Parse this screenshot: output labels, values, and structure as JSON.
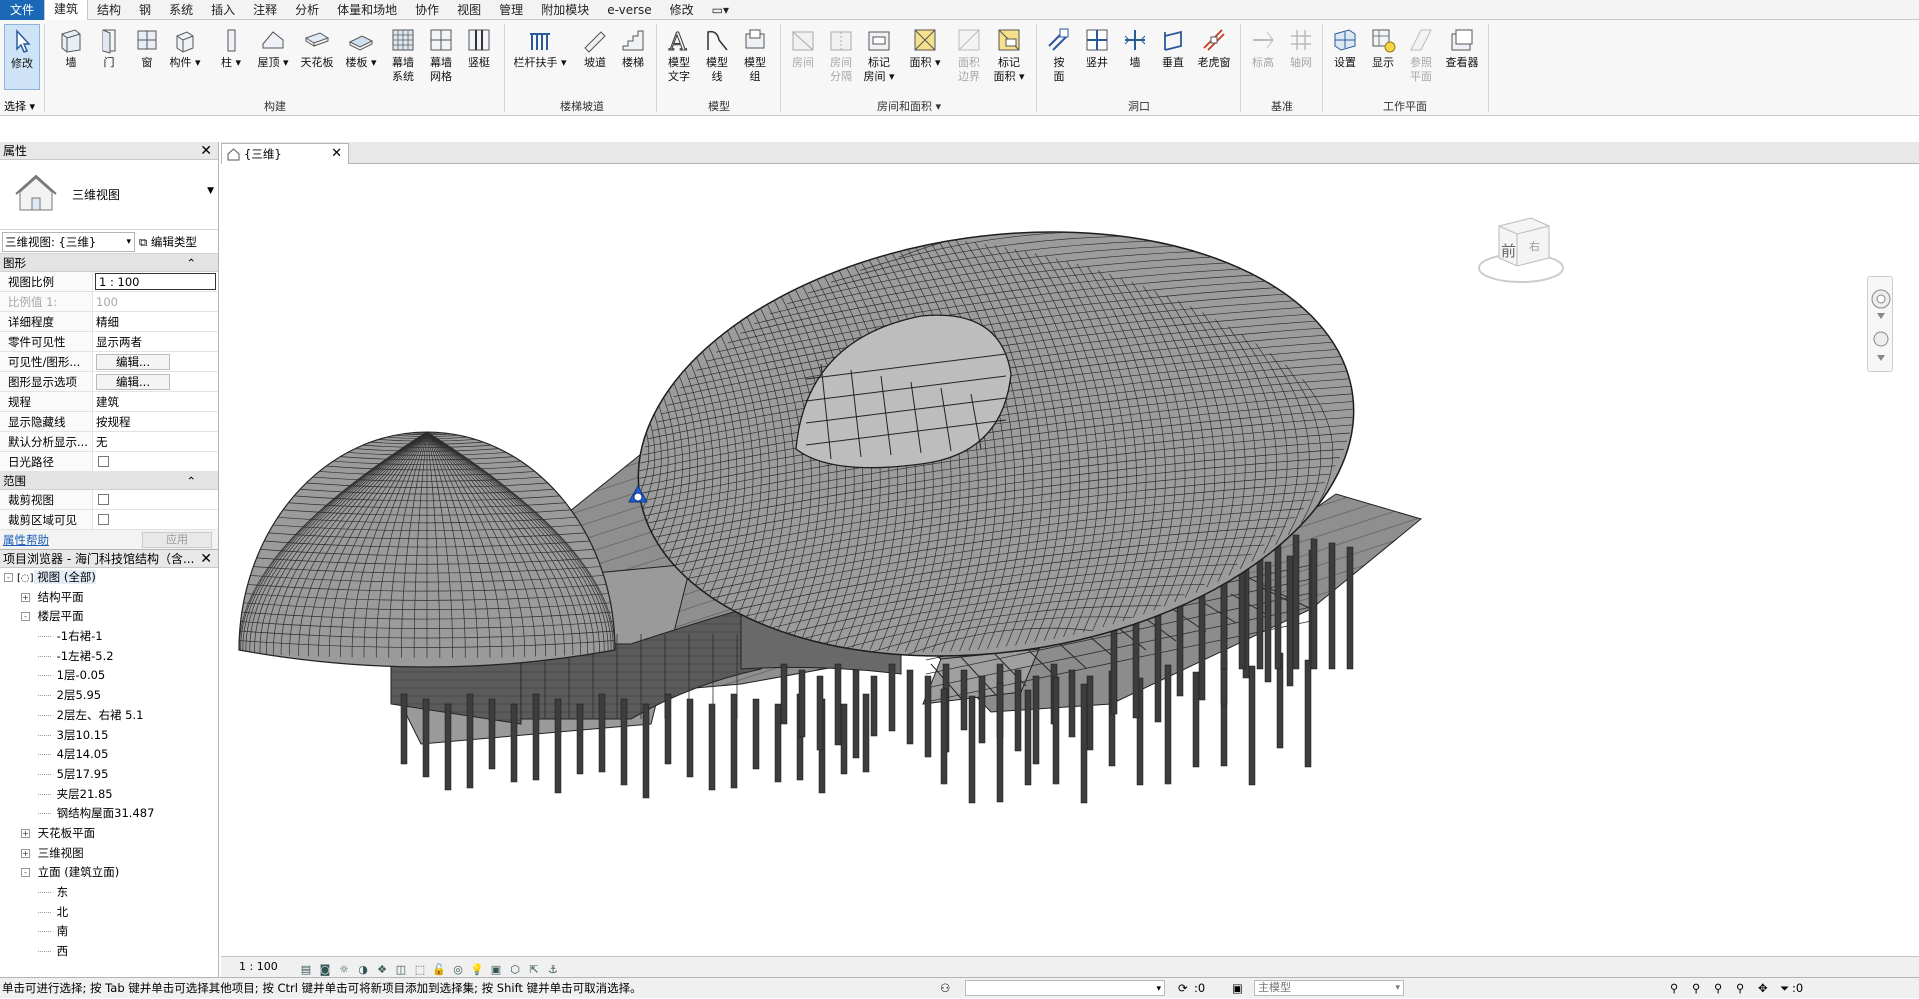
{
  "menu": {
    "tabs": [
      "文件",
      "建筑",
      "结构",
      "钢",
      "系统",
      "插入",
      "注释",
      "分析",
      "体量和场地",
      "协作",
      "视图",
      "管理",
      "附加模块",
      "e-verse",
      "修改"
    ],
    "active": "建筑"
  },
  "ribbon": {
    "modify": {
      "label": "修改"
    },
    "select_label": "选择",
    "build": {
      "label": "构建",
      "wall": "墙",
      "door": "门",
      "window": "窗",
      "component": "构件",
      "column": "柱",
      "roof": "屋顶",
      "ceiling": "天花板",
      "floor": "楼板",
      "curtain_system_l1": "幕墙",
      "curtain_system_l2": "系统",
      "curtain_grid_l1": "幕墙",
      "curtain_grid_l2": "网格",
      "mullion": "竖梃"
    },
    "circulation": {
      "label": "楼梯坡道",
      "railing": "栏杆扶手",
      "ramp": "坡道",
      "stair": "楼梯"
    },
    "model": {
      "label": "模型",
      "text_l1": "模型",
      "text_l2": "文字",
      "line_l1": "模型",
      "line_l2": "线",
      "group_l1": "模型",
      "group_l2": "组"
    },
    "room_area": {
      "label": "房间和面积",
      "room": "房间",
      "room_sep_l1": "房间",
      "room_sep_l2": "分隔",
      "tag_room_l1": "标记",
      "tag_room_l2": "房间",
      "area": "面积",
      "area_boundary_l1": "面积",
      "area_boundary_l2": "边界",
      "tag_area_l1": "标记",
      "tag_area_l2": "面积"
    },
    "opening": {
      "label": "洞口",
      "by_face_l1": "按",
      "by_face_l2": "面",
      "shaft": "竖井",
      "wall": "墙",
      "vertical": "垂直",
      "dormer": "老虎窗"
    },
    "datum": {
      "label": "基准",
      "level": "标高",
      "grid": "轴网"
    },
    "workplane": {
      "label": "工作平面",
      "set": "设置",
      "show": "显示",
      "ref_plane_l1": "参照",
      "ref_plane_l2": "平面",
      "viewer": "查看器"
    }
  },
  "properties": {
    "title": "属性",
    "type_name": "三维视图",
    "selector": "三维视图: {三维}",
    "edit_type": "编辑类型",
    "graphics_header": "图形",
    "rows": [
      {
        "k": "视图比例",
        "v": "1 : 100"
      },
      {
        "k": "比例值 1:",
        "v": "100"
      },
      {
        "k": "详细程度",
        "v": "精细"
      },
      {
        "k": "零件可见性",
        "v": "显示两者"
      },
      {
        "k": "可见性/图形...",
        "v": "编辑..."
      },
      {
        "k": "图形显示选项",
        "v": "编辑..."
      },
      {
        "k": "规程",
        "v": "建筑"
      },
      {
        "k": "显示隐藏线",
        "v": "按规程"
      },
      {
        "k": "默认分析显示...",
        "v": "无"
      },
      {
        "k": "日光路径",
        "v": ""
      }
    ],
    "extents_header": "范围",
    "extents_rows": [
      {
        "k": "裁剪视图",
        "v": ""
      },
      {
        "k": "裁剪区域可见",
        "v": ""
      }
    ],
    "help": "属性帮助",
    "apply": "应用"
  },
  "browser": {
    "title": "项目浏览器 - 海门科技馆结构（含...",
    "items": [
      {
        "label": "视图 (全部)",
        "level": 0,
        "exp": "-"
      },
      {
        "label": "结构平面",
        "level": 1,
        "exp": "+"
      },
      {
        "label": "楼层平面",
        "level": 1,
        "exp": "-"
      },
      {
        "label": "-1右裙-1",
        "level": 2,
        "exp": ""
      },
      {
        "label": "-1左裙-5.2",
        "level": 2,
        "exp": ""
      },
      {
        "label": "1层-0.05",
        "level": 2,
        "exp": ""
      },
      {
        "label": "2层5.95",
        "level": 2,
        "exp": ""
      },
      {
        "label": "2层左、右裙 5.1",
        "level": 2,
        "exp": ""
      },
      {
        "label": "3层10.15",
        "level": 2,
        "exp": ""
      },
      {
        "label": "4层14.05",
        "level": 2,
        "exp": ""
      },
      {
        "label": "5层17.95",
        "level": 2,
        "exp": ""
      },
      {
        "label": "夹层21.85",
        "level": 2,
        "exp": ""
      },
      {
        "label": "钢结构屋面31.487",
        "level": 2,
        "exp": ""
      },
      {
        "label": "天花板平面",
        "level": 1,
        "exp": "+"
      },
      {
        "label": "三维视图",
        "level": 1,
        "exp": "+"
      },
      {
        "label": "立面 (建筑立面)",
        "level": 1,
        "exp": "-"
      },
      {
        "label": "东",
        "level": 2,
        "exp": ""
      },
      {
        "label": "北",
        "level": 2,
        "exp": ""
      },
      {
        "label": "南",
        "level": 2,
        "exp": ""
      },
      {
        "label": "西",
        "level": 2,
        "exp": ""
      }
    ]
  },
  "view_tab": {
    "label": "{三维}"
  },
  "viewcube": {
    "face": "前",
    "side": "右"
  },
  "view_bar": {
    "scale": "1 : 100"
  },
  "status": {
    "message": "单击可进行选择; 按 Tab 键并单击可选择其他项目; 按 Ctrl 键并单击可将新项目添加到选择集; 按 Shift 键并单击可取消选择。",
    "worksets_value": ":0",
    "model": "主模型",
    "filter_value": ":0"
  },
  "colors": {
    "file_tab": "#1b68b6",
    "selection": "#cfe3f7",
    "model_lines": "#2a2a2a",
    "project_base": "#1f5fd1"
  }
}
